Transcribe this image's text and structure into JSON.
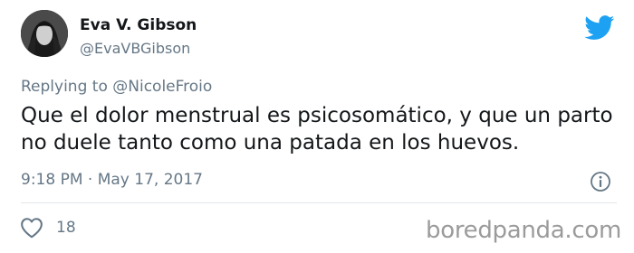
{
  "tweet": {
    "display_name": "Eva V. Gibson",
    "handle": "@EvaVBGibson",
    "replying_prefix": "Replying to",
    "replying_to": "@NicoleFroio",
    "text": "Que el dolor menstrual es psicosomático, y que un parto no duele tanto como una patada en los huevos.",
    "timestamp": "9:18 PM · May 17, 2017",
    "like_count": "18"
  },
  "icons": {
    "brand": "twitter-bird-icon",
    "info": "info-icon",
    "like": "heart-icon"
  },
  "colors": {
    "twitter_blue": "#1da1f2",
    "secondary_text": "#657786",
    "primary_text": "#14171a"
  },
  "watermark": {
    "text": "boredpanda.com"
  }
}
